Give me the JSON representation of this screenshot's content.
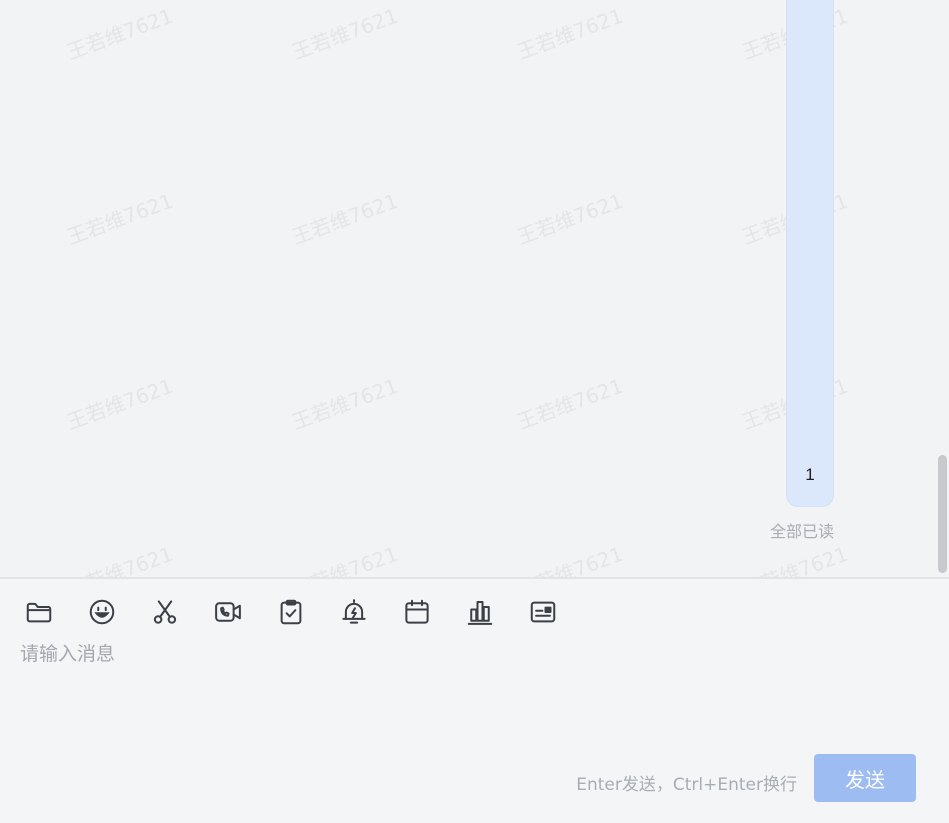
{
  "watermark": {
    "text": "王若维7621"
  },
  "chat": {
    "message": {
      "text": "1"
    },
    "read_status": "全部已读"
  },
  "toolbar": {
    "icons": [
      "folder-icon",
      "emoji-icon",
      "scissors-icon",
      "video-call-icon",
      "clipboard-check-icon",
      "alarm-bell-icon",
      "calendar-icon",
      "bar-chart-icon",
      "card-icon"
    ]
  },
  "composer": {
    "placeholder": "请输入消息",
    "hint": "Enter发送，Ctrl+Enter换行",
    "send_label": "发送"
  },
  "colors": {
    "bubble": "#dbe8fb",
    "send_button": "#9dbcf2",
    "icon_stroke": "#3b3f46"
  }
}
